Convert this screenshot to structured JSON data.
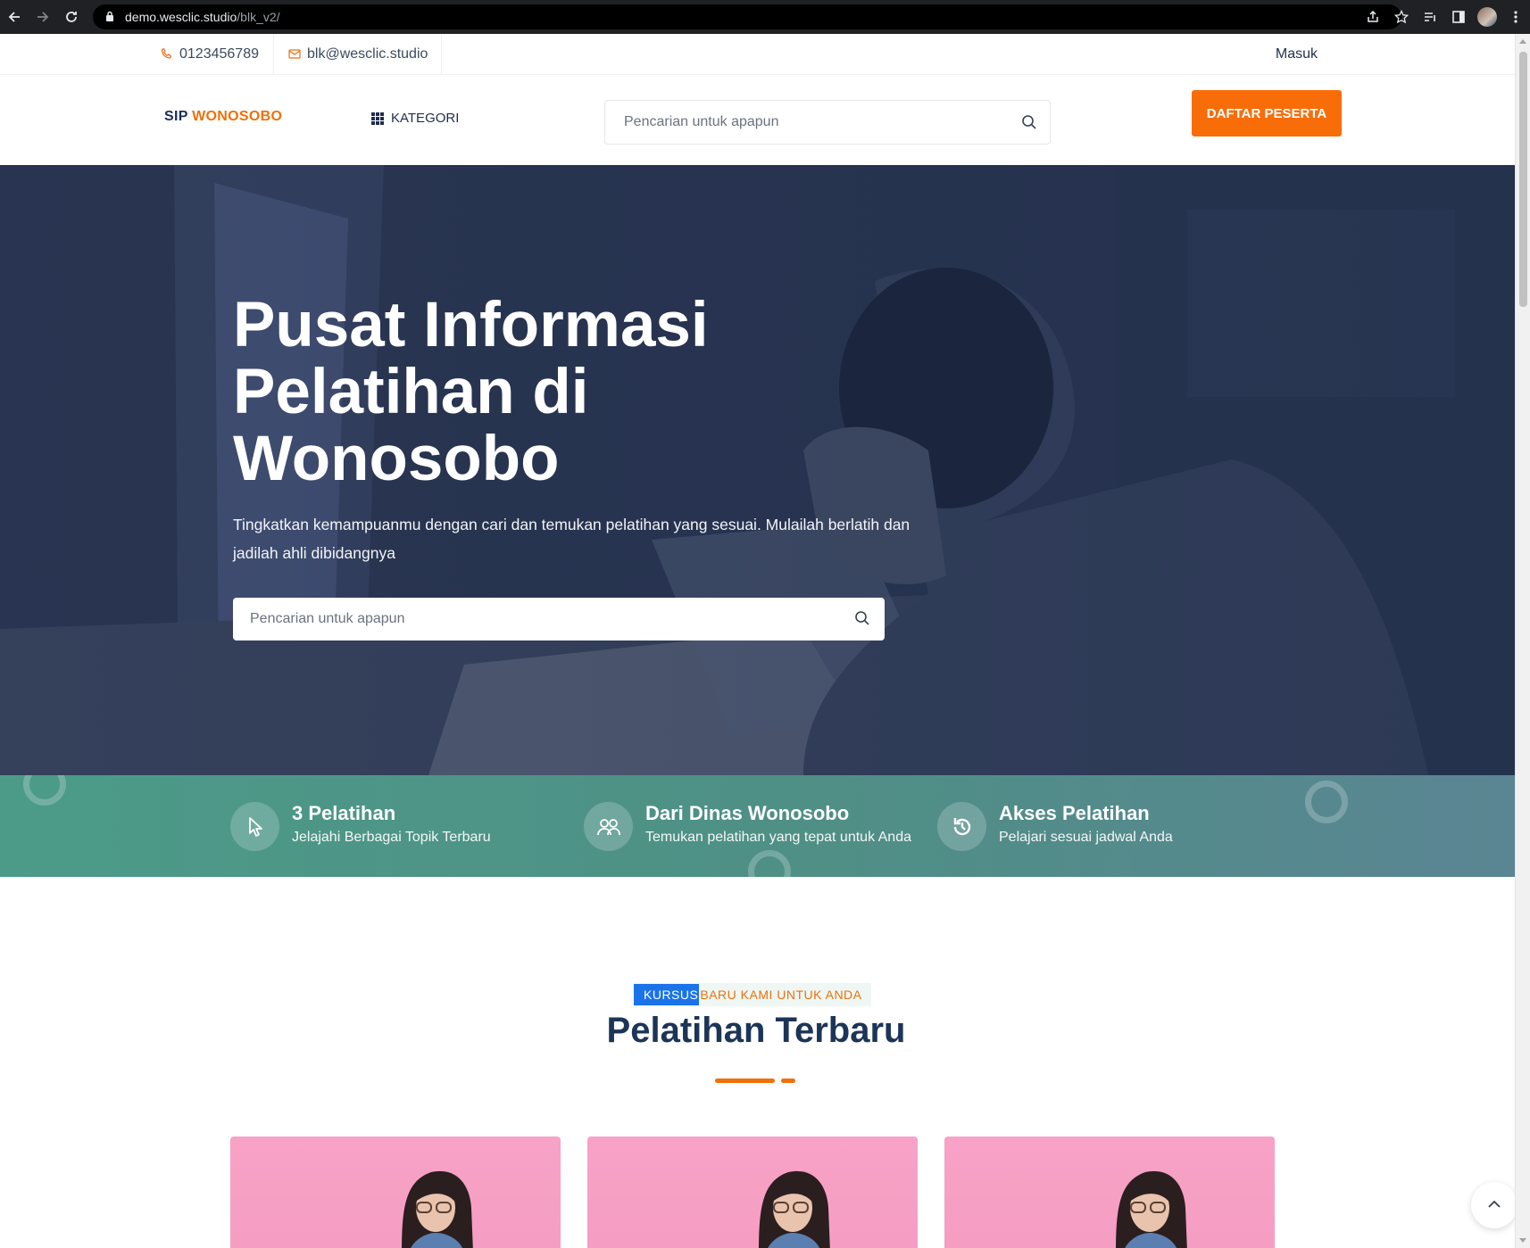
{
  "browser": {
    "url_host": "demo.wesclic.studio",
    "url_path": "/blk_v2/"
  },
  "topbar": {
    "phone": "0123456789",
    "email": "blk@wesclic.studio",
    "login": "Masuk"
  },
  "header": {
    "logo_a": "SIP",
    "logo_b": "WONOSOBO",
    "kategori": "KATEGORI",
    "search_placeholder": "Pencarian untuk apapun",
    "cta": "DAFTAR PESERTA"
  },
  "hero": {
    "title": "Pusat Informasi Pelatihan di Wonosobo",
    "subtitle": "Tingkatkan kemampuanmu dengan cari dan temukan pelatihan yang sesuai. Mulailah berlatih dan jadilah ahli dibidangnya",
    "search_placeholder": "Pencarian untuk apapun"
  },
  "features": [
    {
      "icon": "pointer-icon",
      "title": "3 Pelatihan",
      "subtitle": "Jelajahi Berbagai Topik Terbaru"
    },
    {
      "icon": "users-icon",
      "title": "Dari Dinas Wonosobo",
      "subtitle": "Temukan pelatihan yang tepat untuk Anda"
    },
    {
      "icon": "history-icon",
      "title": "Akses Pelatihan",
      "subtitle": "Pelajari sesuai jadwal Anda"
    }
  ],
  "section": {
    "tag_selected": "KURSUS",
    "tag_rest": " BARU KAMI UNTUK ANDA",
    "title": "Pelatihan Terbaru"
  },
  "colors": {
    "accent": "#f96d08",
    "navy": "#1c3557",
    "teal": "#4c9b88"
  }
}
